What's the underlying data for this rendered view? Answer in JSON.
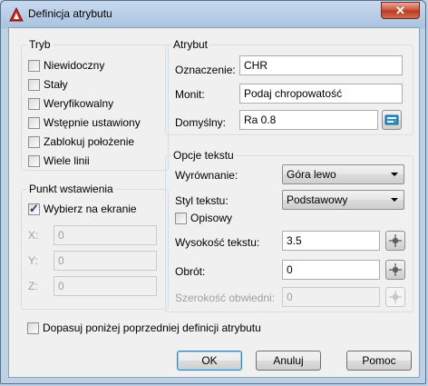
{
  "window": {
    "title": "Definicja atrybutu"
  },
  "tryb": {
    "legend": "Tryb",
    "items": [
      {
        "label": "Niewidoczny",
        "checked": false
      },
      {
        "label": "Stały",
        "checked": false
      },
      {
        "label": "Weryfikowalny",
        "checked": false
      },
      {
        "label": "Wstępnie ustawiony",
        "checked": false
      },
      {
        "label": "Zablokuj położenie",
        "checked": false
      },
      {
        "label": "Wiele linii",
        "checked": false
      }
    ]
  },
  "punkt": {
    "legend": "Punkt wstawienia",
    "pick_label": "Wybierz na ekranie",
    "pick_checked": true,
    "x_label": "X:",
    "x_value": "0",
    "y_label": "Y:",
    "y_value": "0",
    "z_label": "Z:",
    "z_value": "0"
  },
  "atrybut": {
    "legend": "Atrybut",
    "tag_label": "Oznaczenie:",
    "tag_value": "CHR",
    "prompt_label": "Monit:",
    "prompt_value": "Podaj chropowatość",
    "default_label": "Domyślny:",
    "default_value": "Ra 0.8"
  },
  "opcje": {
    "legend": "Opcje tekstu",
    "justify_label": "Wyrównanie:",
    "justify_value": "Góra lewo",
    "style_label": "Styl tekstu:",
    "style_value": "Podstawowy",
    "annotative_label": "Opisowy",
    "annotative_checked": false,
    "height_label": "Wysokość tekstu:",
    "height_value": "3.5",
    "rotation_label": "Obrót:",
    "rotation_value": "0",
    "width_label": "Szerokość obwiedni:",
    "width_value": "0"
  },
  "align_below": {
    "label": "Dopasuj poniżej poprzedniej definicji atrybutu",
    "checked": false
  },
  "buttons": {
    "ok": "OK",
    "cancel": "Anuluj",
    "help": "Pomoc"
  }
}
